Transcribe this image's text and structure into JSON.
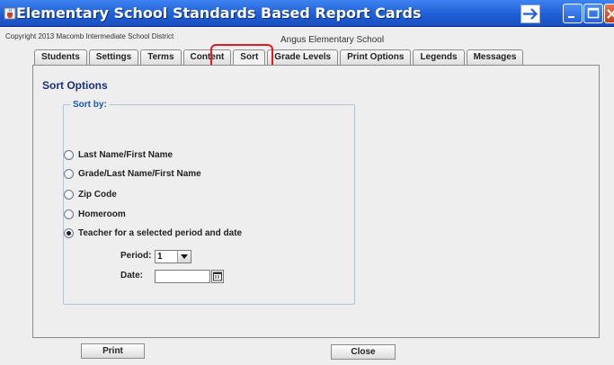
{
  "window": {
    "title": "Elementary School Standards Based Report Cards",
    "icons": {
      "app": "java-cup-icon",
      "nav": "arrow-right-icon",
      "minimize": "minimize-icon",
      "maximize": "maximize-icon",
      "close": "close-icon"
    }
  },
  "header": {
    "copyright": "Copyright 2013 Macomb Intermediate School District",
    "school": "Angus Elementary School"
  },
  "tabs": [
    {
      "label": "Students"
    },
    {
      "label": "Settings"
    },
    {
      "label": "Terms"
    },
    {
      "label": "Content"
    },
    {
      "label": "Sort",
      "active": true
    },
    {
      "label": "Grade Levels"
    },
    {
      "label": "Print Options"
    },
    {
      "label": "Legends"
    },
    {
      "label": "Messages"
    }
  ],
  "sort_panel": {
    "title": "Sort Options",
    "group_label": "Sort by:",
    "options": [
      {
        "label": "Last Name/First Name",
        "checked": false
      },
      {
        "label": "Grade/Last Name/First Name",
        "checked": false
      },
      {
        "label": "Zip Code",
        "checked": false
      },
      {
        "label": "Homeroom",
        "checked": false
      },
      {
        "label": "Teacher for a selected period and date",
        "checked": true
      }
    ],
    "period": {
      "label": "Period:",
      "value": "1"
    },
    "date": {
      "label": "Date:",
      "value": ""
    }
  },
  "buttons": {
    "print": "Print",
    "close": "Close"
  },
  "colors": {
    "title_bar": "#2563d8",
    "section_title": "#1b2f7a",
    "group_label": "#1a57b0",
    "highlight": "#e01b1b"
  }
}
